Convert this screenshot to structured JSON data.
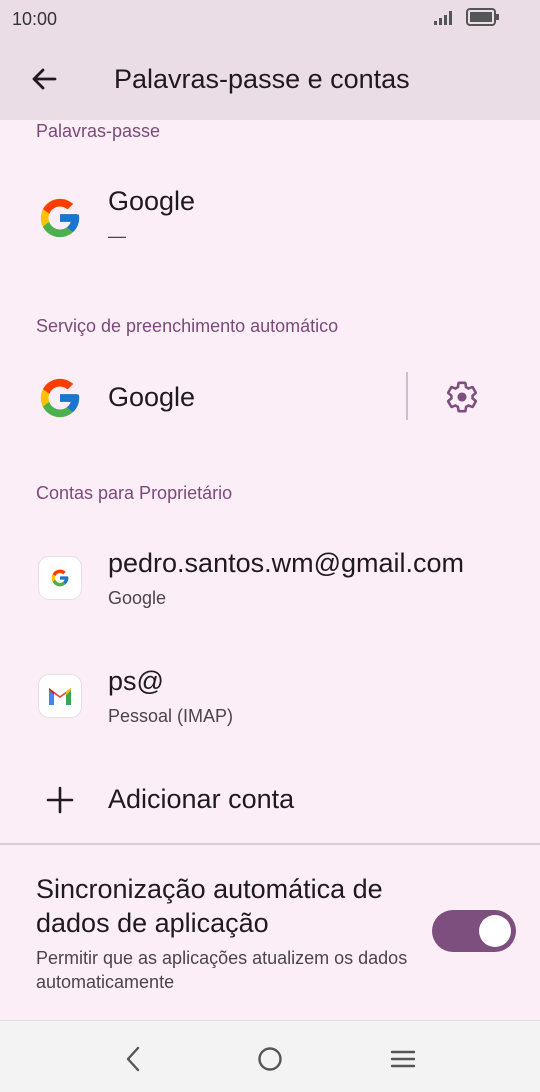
{
  "status_bar": {
    "time": "10:00"
  },
  "app_bar": {
    "title": "Palavras-passe e contas"
  },
  "passwords_section": {
    "header": "Palavras-passe",
    "item": {
      "title": "Google",
      "subtitle": "—"
    }
  },
  "autofill_section": {
    "header": "Serviço de preenchimento automático",
    "item": {
      "title": "Google"
    }
  },
  "accounts_section": {
    "header": "Contas para Proprietário",
    "accounts": [
      {
        "title": "pedro.santos.wm@gmail.com",
        "subtitle": "Google",
        "icon": "google-icon"
      },
      {
        "title": "ps@",
        "subtitle": "Pessoal (IMAP)",
        "icon": "gmail-icon"
      }
    ],
    "add_account": "Adicionar conta"
  },
  "sync": {
    "title": "Sincronização automática de dados de aplicação",
    "subtitle": "Permitir que as aplicações atualizem os dados automaticamente",
    "enabled": true
  },
  "colors": {
    "accent": "#7d4f7e",
    "section_header": "#7b4a7a",
    "background": "#fbeef6"
  }
}
